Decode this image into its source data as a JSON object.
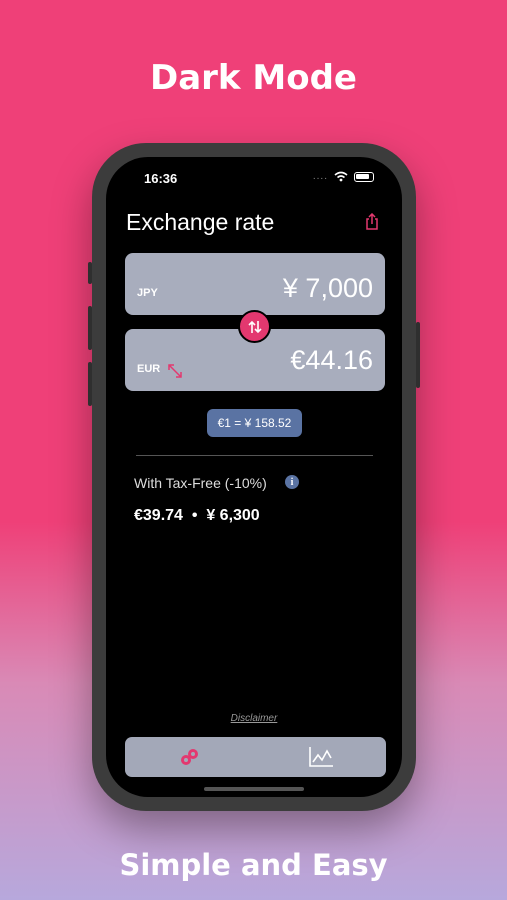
{
  "promo": {
    "top_text": "Dark Mode",
    "bottom_text": "Simple and Easy"
  },
  "status_bar": {
    "time": "16:36",
    "signal_dots": "....",
    "icons": [
      "wifi-icon",
      "battery-icon"
    ]
  },
  "header": {
    "title": "Exchange rate",
    "share_icon": "share-icon"
  },
  "converter": {
    "from": {
      "code": "JPY",
      "amount": "¥ 7,000"
    },
    "to": {
      "code": "EUR",
      "amount": "€44.16",
      "icon": "expand-arrows-icon"
    },
    "swap_icon": "swap-arrows-icon",
    "rate": "€1 = ¥ 158.52"
  },
  "tax_free": {
    "label": "With Tax-Free (-10%)",
    "info_icon": "i",
    "values": "€39.74  •  ¥ 6,300"
  },
  "footer": {
    "disclaimer": "Disclaimer"
  },
  "tabs": [
    {
      "name": "converter",
      "icon": "coins-icon"
    },
    {
      "name": "chart",
      "icon": "chart-icon"
    }
  ],
  "colors": {
    "accent": "#e3386f",
    "badge": "#5a73a3",
    "card": "#a8adbd",
    "background_pink": "#ef4078"
  }
}
